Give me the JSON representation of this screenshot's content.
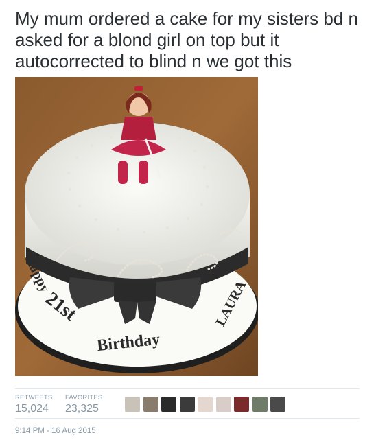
{
  "tweet": {
    "text": "My mum ordered a cake for my sisters bd n asked for a blond girl on top but it autocorrected to blind n we got this"
  },
  "photo": {
    "cake_inscription": {
      "happy": "Happy",
      "age": "21st",
      "birthday": "Birthday",
      "name": "LAURA"
    }
  },
  "stats": {
    "retweets_label": "RETWEETS",
    "retweets_value": "15,024",
    "favorites_label": "FAVORITES",
    "favorites_value": "23,325"
  },
  "avatars": [
    {
      "name": "avatar-1",
      "color": "#c9c2b8"
    },
    {
      "name": "avatar-2",
      "color": "#8a7c6d"
    },
    {
      "name": "avatar-3",
      "color": "#2a2a2a"
    },
    {
      "name": "avatar-4",
      "color": "#3b3b3b"
    },
    {
      "name": "avatar-5",
      "color": "#e3d7cf"
    },
    {
      "name": "avatar-6",
      "color": "#d8cdc8"
    },
    {
      "name": "avatar-7",
      "color": "#7a2a2a"
    },
    {
      "name": "avatar-8",
      "color": "#6f7c6a"
    },
    {
      "name": "avatar-9",
      "color": "#4a4a4a"
    }
  ],
  "timestamp": "9:14 PM - 16 Aug 2015"
}
